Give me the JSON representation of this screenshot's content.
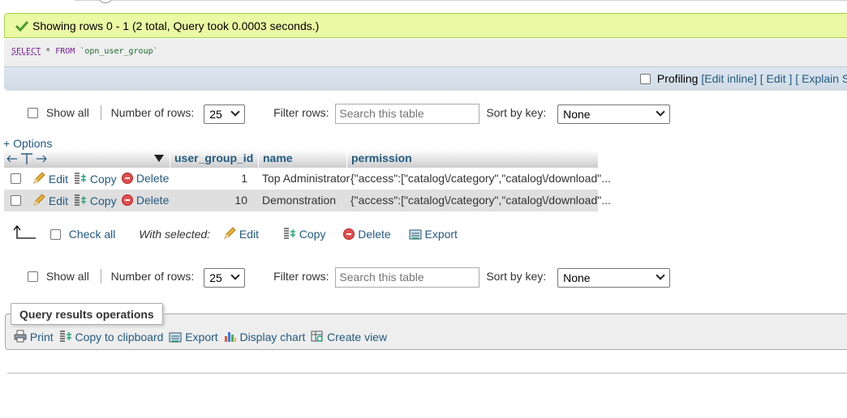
{
  "message": {
    "text": "Showing rows 0 - 1 (2 total, Query took 0.0003 seconds.)"
  },
  "sql": {
    "select": "SELECT",
    "star": " * ",
    "from": "FROM",
    "table": " `opn_user_group`"
  },
  "profiling": {
    "label": "Profiling",
    "edit_inline": "[Edit inline]",
    "edit": "[ Edit ]",
    "explain": "[ Explain SQL ]"
  },
  "nav": {
    "show_all": "Show all",
    "rows_label": "Number of rows:",
    "rows_value": "25",
    "filter_label": "Filter rows:",
    "filter_placeholder": "Search this table",
    "sort_label": "Sort by key:",
    "sort_value": "None"
  },
  "options": "+ Options",
  "table": {
    "columns": [
      "user_group_id",
      "name",
      "permission"
    ],
    "actions": {
      "edit": "Edit",
      "copy": "Copy",
      "delete": "Delete"
    },
    "rows": [
      {
        "id": "1",
        "name": "Top Administrator",
        "permission": "{\"access\":[\"catalog\\/category\",\"catalog\\/download\"..."
      },
      {
        "id": "10",
        "name": "Demonstration",
        "permission": "{\"access\":[\"catalog\\/category\",\"catalog\\/download\"..."
      }
    ]
  },
  "bulk": {
    "check_all": "Check all",
    "with_selected": "With selected:",
    "edit": "Edit",
    "copy": "Copy",
    "delete": "Delete",
    "export": "Export"
  },
  "qro": {
    "title": "Query results operations",
    "print": "Print",
    "copy": "Copy to clipboard",
    "export": "Export",
    "chart": "Display chart",
    "view": "Create view"
  },
  "colors": {
    "accent": "#235a81",
    "success_bg": "#ebf8a4",
    "success_border": "#a2d246"
  }
}
